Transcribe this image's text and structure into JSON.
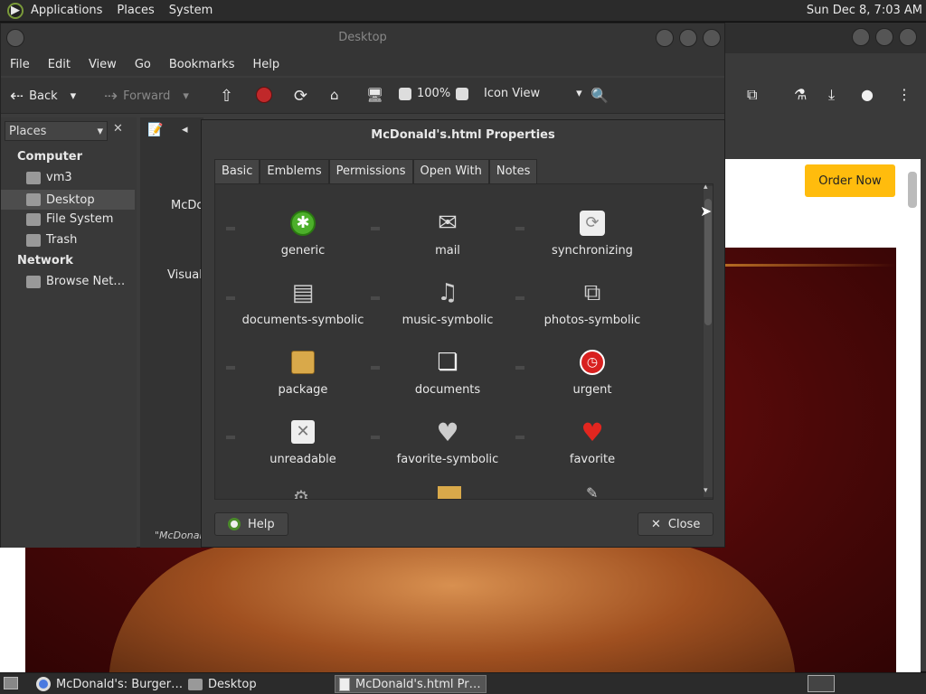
{
  "top_panel": {
    "menus": [
      "Applications",
      "Places",
      "System"
    ],
    "clock": "Sun Dec  8,  7:03 AM"
  },
  "browser": {
    "order_button": "Order Now",
    "colors": {
      "order": "#ffbc0d",
      "promo": "#7a1010"
    }
  },
  "nautilus": {
    "title": "Desktop",
    "menu": [
      "File",
      "Edit",
      "View",
      "Go",
      "Bookmarks",
      "Help"
    ],
    "toolbar": {
      "back": "Back",
      "forward": "Forward",
      "zoom": "100%",
      "view_mode": "Icon View"
    },
    "sidebar": {
      "selector": "Places",
      "sections": [
        {
          "heading": "Computer",
          "items": [
            "vm3",
            "Desktop",
            "File System",
            "Trash"
          ]
        },
        {
          "heading": "Network",
          "items": [
            "Browse Net…"
          ]
        }
      ],
      "selected": "Desktop"
    },
    "content_fragments": [
      "McDo",
      "Visual",
      "\"McDonal"
    ]
  },
  "dialog": {
    "title": "McDonald's.html Properties",
    "tabs": [
      "Basic",
      "Emblems",
      "Permissions",
      "Open With",
      "Notes"
    ],
    "active_tab": "Emblems",
    "emblems": [
      {
        "label": "generic",
        "icon": "generic-emblem-icon"
      },
      {
        "label": "mail",
        "icon": "mail-icon"
      },
      {
        "label": "synchronizing",
        "icon": "sync-icon"
      },
      {
        "label": "documents-symbolic",
        "icon": "documents-symbolic-icon"
      },
      {
        "label": "music-symbolic",
        "icon": "music-icon"
      },
      {
        "label": "photos-symbolic",
        "icon": "photos-icon"
      },
      {
        "label": "package",
        "icon": "package-icon"
      },
      {
        "label": "documents",
        "icon": "documents-icon"
      },
      {
        "label": "urgent",
        "icon": "urgent-icon"
      },
      {
        "label": "unreadable",
        "icon": "unreadable-icon"
      },
      {
        "label": "favorite-symbolic",
        "icon": "heart-outline-icon"
      },
      {
        "label": "favorite",
        "icon": "heart-icon"
      }
    ],
    "help_button": "Help",
    "close_button": "Close"
  },
  "taskbar": {
    "tasks": [
      "McDonald's: Burger…",
      "Desktop",
      "McDonald's.html Pr…"
    ],
    "active_task": "McDonald's.html Pr…"
  }
}
